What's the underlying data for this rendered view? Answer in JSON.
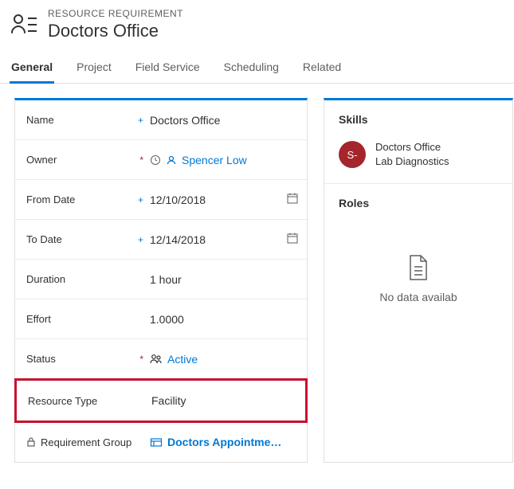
{
  "header": {
    "caption": "RESOURCE REQUIREMENT",
    "title": "Doctors Office"
  },
  "tabs": {
    "general": "General",
    "project": "Project",
    "field_service": "Field Service",
    "scheduling": "Scheduling",
    "related": "Related"
  },
  "form": {
    "name_label": "Name",
    "name_value": "Doctors Office",
    "owner_label": "Owner",
    "owner_value": "Spencer Low",
    "from_label": "From Date",
    "from_value": "12/10/2018",
    "to_label": "To Date",
    "to_value": "12/14/2018",
    "duration_label": "Duration",
    "duration_value": "1 hour",
    "effort_label": "Effort",
    "effort_value": "1.0000",
    "status_label": "Status",
    "status_value": "Active",
    "restype_label": "Resource Type",
    "restype_value": "Facility",
    "reqgroup_label": "Requirement Group",
    "reqgroup_value": "Doctors Appointme…"
  },
  "right": {
    "skills_header": "Skills",
    "skill_avatar": "S-",
    "skill_line1": "Doctors Office",
    "skill_line2": "Lab Diagnostics",
    "roles_header": "Roles",
    "no_data": "No data availab"
  }
}
